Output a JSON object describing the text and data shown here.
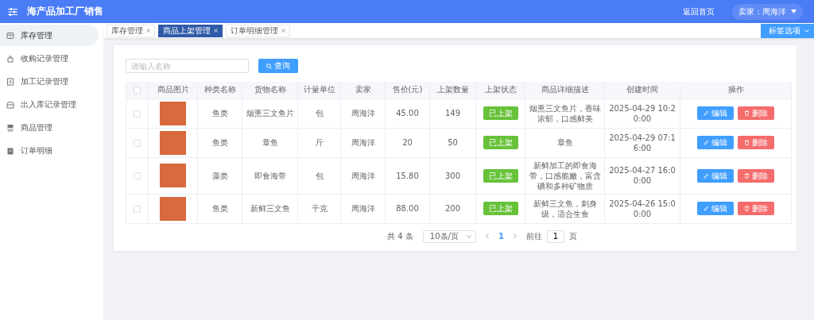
{
  "header": {
    "title": "海产品加工厂销售",
    "home_link": "返回首页",
    "user_menu": "卖家：周海洋"
  },
  "sidebar": {
    "items": [
      {
        "label": "库存管理",
        "selected": true
      },
      {
        "label": "收购记录管理",
        "selected": false
      },
      {
        "label": "加工记录管理",
        "selected": false
      },
      {
        "label": "出入库记录管理",
        "selected": false
      },
      {
        "label": "商品管理",
        "selected": false
      },
      {
        "label": "订单明细",
        "selected": false
      }
    ]
  },
  "tabs": [
    {
      "label": "库存管理",
      "selected": false
    },
    {
      "label": "商品上架管理",
      "selected": true
    },
    {
      "label": "订单明细管理",
      "selected": false
    }
  ],
  "tab_options_button": "标签选项",
  "search": {
    "placeholder": "请输入名称",
    "button": "查询"
  },
  "table": {
    "header_checkbox": {
      "checked": false
    },
    "columns": [
      "商品图片",
      "种类名称",
      "货物名称",
      "计量单位",
      "卖家",
      "售价(元)",
      "上架数量",
      "上架状态",
      "商品详细描述",
      "创建时间",
      "操作"
    ],
    "rows": [
      {
        "checked": false,
        "category": "鱼类",
        "name": "烟熏三文鱼片",
        "unit": "包",
        "seller": "周海洋",
        "price": "45.00",
        "quantity": "149",
        "status": "已上架",
        "description": "烟熏三文鱼片，香味浓郁，口感鲜美",
        "created": "2025-04-29 10:20:00",
        "edit": "编辑",
        "delete": "删除"
      },
      {
        "checked": false,
        "category": "鱼类",
        "name": "章鱼",
        "unit": "斤",
        "seller": "周海洋",
        "price": "20",
        "quantity": "50",
        "status": "已上架",
        "description": "章鱼",
        "created": "2025-04-29 07:16:00",
        "edit": "编辑",
        "delete": "删除"
      },
      {
        "checked": false,
        "category": "藻类",
        "name": "即食海带",
        "unit": "包",
        "seller": "周海洋",
        "price": "15.80",
        "quantity": "300",
        "status": "已上架",
        "description": "新鲜加工的即食海带，口感脆嫩，富含碘和多种矿物质",
        "created": "2025-04-27 16:00:00",
        "edit": "编辑",
        "delete": "删除"
      },
      {
        "checked": false,
        "category": "鱼类",
        "name": "新鲜三文鱼",
        "unit": "千克",
        "seller": "周海洋",
        "price": "88.00",
        "quantity": "200",
        "status": "已上架",
        "description": "新鲜三文鱼，刺身级，适合生食",
        "created": "2025-04-26 15:00:00",
        "edit": "编辑",
        "delete": "删除"
      }
    ]
  },
  "pagination": {
    "total": "共 4 条",
    "page_size": "10条/页",
    "pages": [
      {
        "label": "1",
        "selected": true
      }
    ],
    "goto_label": "前往",
    "goto_value": "1",
    "goto_suffix": "页"
  }
}
